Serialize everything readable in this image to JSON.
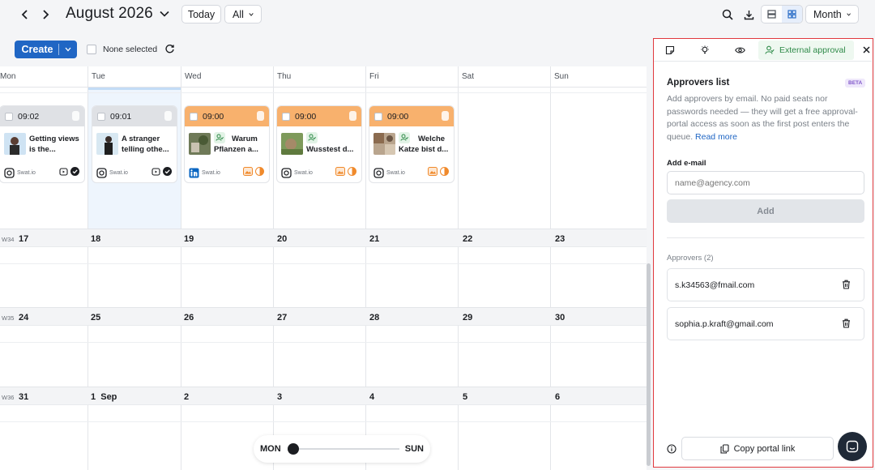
{
  "header": {
    "title": "August 2026",
    "today_label": "Today",
    "filter_label": "All",
    "view_label": "Month"
  },
  "toolbar": {
    "create_label": "Create",
    "selection_label": "None selected"
  },
  "calendar": {
    "day_names": [
      "Mon",
      "Tue",
      "Wed",
      "Thu",
      "Fri",
      "Sat",
      "Sun"
    ],
    "weeks": [
      {
        "label": "W34",
        "dates": [
          "17",
          "18",
          "19",
          "20",
          "21",
          "22",
          "23"
        ]
      },
      {
        "label": "W35",
        "dates": [
          "24",
          "25",
          "26",
          "27",
          "28",
          "29",
          "30"
        ]
      },
      {
        "label": "W36",
        "dates": [
          "31",
          "1  Sep",
          "2",
          "3",
          "4",
          "5",
          "6"
        ]
      }
    ],
    "posts": [
      {
        "time": "09:02",
        "text": "Getting views is the...",
        "brand": "Swat.io",
        "network": "instagram"
      },
      {
        "time": "09:01",
        "text": "A stranger telling othe...",
        "brand": "Swat.io",
        "network": "instagram"
      },
      {
        "time": "09:00",
        "text": "Warum Pflanzen a...",
        "brand": "Swat.io",
        "network": "linkedin"
      },
      {
        "time": "09:00",
        "text": "Wusstest d...",
        "brand": "Swat.io",
        "network": "instagram"
      },
      {
        "time": "09:00",
        "text": "Welche Katze bist d...",
        "brand": "Swat.io",
        "network": "instagram"
      }
    ]
  },
  "slider": {
    "start_label": "MON",
    "end_label": "SUN"
  },
  "panel": {
    "active_tab": "External approval",
    "title": "Approvers list",
    "badge": "BETA",
    "description": "Add approvers by email. No paid seats nor passwords needed — they will get a free approval-portal access as soon as the first post enters the queue.",
    "read_more": "Read more",
    "email_label": "Add e-mail",
    "email_placeholder": "name@agency.com",
    "add_label": "Add",
    "approvers_label": "Approvers (2)",
    "approvers": [
      "s.k34563@fmail.com",
      "sophia.p.kraft@gmail.com"
    ],
    "copy_label": "Copy portal link"
  },
  "colors": {
    "primary": "#2066c4",
    "card_orange": "#f8b16d",
    "approval_green": "#2e8a48",
    "panel_border": "#e0393e"
  }
}
